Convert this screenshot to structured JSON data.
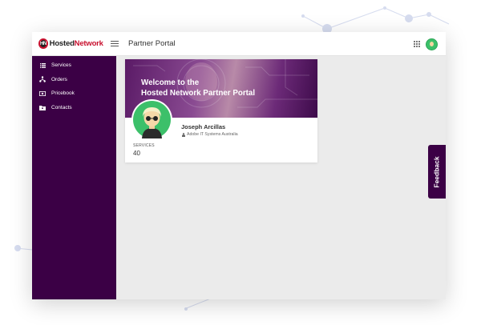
{
  "app": {
    "logo_mark": "HN",
    "logo_text_a": "Hosted",
    "logo_text_b": "Network",
    "page_title": "Partner Portal"
  },
  "sidebar": {
    "items": [
      {
        "label": "Services",
        "icon": "list-icon"
      },
      {
        "label": "Orders",
        "icon": "network-icon"
      },
      {
        "label": "Pricebook",
        "icon": "dollar-icon"
      },
      {
        "label": "Contacts",
        "icon": "folder-icon"
      }
    ]
  },
  "welcome": {
    "title": "Welcome to the\nHosted Network Partner Portal"
  },
  "profile": {
    "name": "Joseph Arcillas",
    "company": "Adobe IT Systems Australia",
    "services_label": "SERVICES",
    "services_value": "40"
  },
  "feedback": {
    "label": "Feedback"
  },
  "colors": {
    "sidebar": "#3b0045",
    "brand_red": "#c8102e",
    "avatar_green": "#3cc06a",
    "content_bg": "#ebebeb"
  }
}
